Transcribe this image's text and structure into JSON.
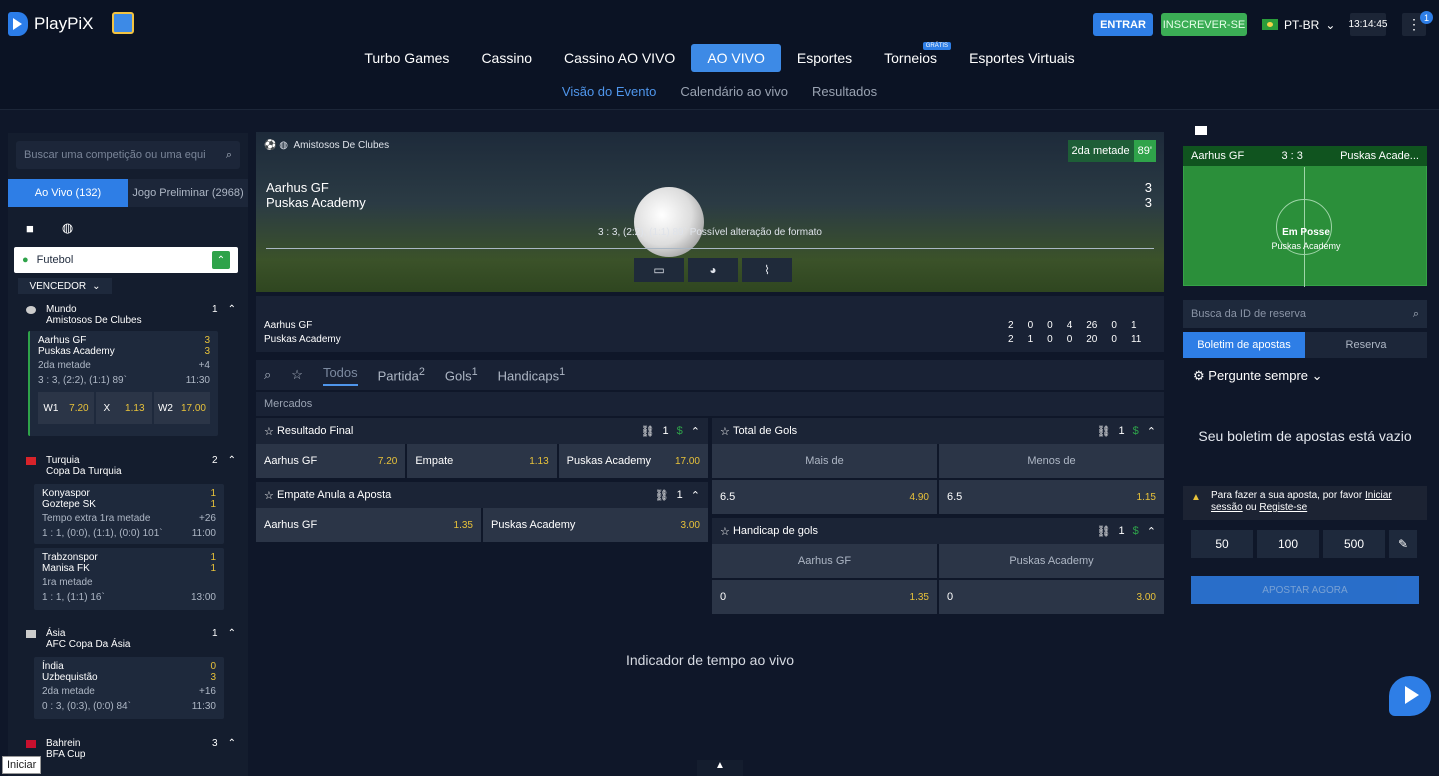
{
  "brand": "PlayPiX",
  "header": {
    "entrar": "ENTRAR",
    "inscrever": "INSCREVER-SE",
    "lang": "PT-BR",
    "clock": "13:14:45",
    "notif": "1"
  },
  "nav": [
    {
      "label": "Turbo Games"
    },
    {
      "label": "Cassino"
    },
    {
      "label": "Cassino AO VIVO"
    },
    {
      "label": "AO VIVO",
      "active": true
    },
    {
      "label": "Esportes"
    },
    {
      "label": "Torneios",
      "badge": "GRÁTIS"
    },
    {
      "label": "Esportes Virtuais"
    }
  ],
  "subnav": [
    {
      "label": "Visão do Evento",
      "active": true
    },
    {
      "label": "Calendário ao vivo"
    },
    {
      "label": "Resultados"
    }
  ],
  "sidebar": {
    "search_placeholder": "Buscar uma competição ou uma equi",
    "tab_live": "Ao Vivo (132)",
    "tab_pre": "Jogo Preliminar (2968)",
    "sport": "Futebol",
    "vencedor": "VENCEDOR",
    "groups": [
      {
        "region": "Mundo",
        "comp": "Amistosos De Clubes",
        "count": "1"
      },
      {
        "region": "Turquia",
        "comp": "Copa Da Turquia",
        "count": "2"
      },
      {
        "region": "Ásia",
        "comp": "AFC Copa Da Ásia",
        "count": "1"
      },
      {
        "region": "Bahrein",
        "comp": "BFA Cup",
        "count": "3"
      }
    ],
    "matches": [
      {
        "home": "Aarhus GF",
        "away": "Puskas Academy",
        "hs": "3",
        "as": "3",
        "status": "2da metade",
        "more": "+4",
        "score": "3 : 3, (2:2), (1:1) 89`",
        "time": "11:30",
        "w1": "W1",
        "w1v": "7.20",
        "x": "X",
        "xv": "1.13",
        "w2": "W2",
        "w2v": "17.00"
      },
      {
        "home": "Konyaspor",
        "away": "Goztepe SK",
        "hs": "1",
        "as": "1",
        "status": "Tempo extra 1ra metade",
        "more": "+26",
        "score": "1 : 1, (0:0), (1:1), (0:0) 101`",
        "time": "11:00"
      },
      {
        "home": "Trabzonspor",
        "away": "Manisa FK",
        "hs": "1",
        "as": "1",
        "status": "1ra metade",
        "more": "",
        "score": "1 : 1, (1:1) 16`",
        "time": "13:00"
      },
      {
        "home": "Índia",
        "away": "Uzbequistão",
        "hs": "0",
        "as": "3",
        "status": "2da metade",
        "more": "+16",
        "score": "0 : 3, (0:3), (0:0) 84`",
        "time": "11:30"
      }
    ]
  },
  "event": {
    "competition": "Amistosos De Clubes",
    "home": "Aarhus GF",
    "away": "Puskas Academy",
    "hs": "3",
    "as": "3",
    "half": "2da metade",
    "minute": "89'",
    "info": "3 : 3, (2:2), (1:1) 89`  Possível alteração de formato",
    "stats_home": [
      "2",
      "0",
      "0",
      "4",
      "26",
      "0",
      "1"
    ],
    "stats_away": [
      "2",
      "1",
      "0",
      "0",
      "20",
      "0",
      "11"
    ]
  },
  "filters": {
    "todos": "Todos",
    "partida": "Partida",
    "partida_n": "2",
    "gols": "Gols",
    "gols_n": "1",
    "handicaps": "Handicaps",
    "handicaps_n": "1",
    "mercados": "Mercados"
  },
  "markets": {
    "resultado": {
      "title": "Resultado Final",
      "n": "1",
      "opts": [
        {
          "l": "Aarhus GF",
          "v": "7.20"
        },
        {
          "l": "Empate",
          "v": "1.13"
        },
        {
          "l": "Puskas Academy",
          "v": "17.00"
        }
      ]
    },
    "empate": {
      "title": "Empate Anula a Aposta",
      "n": "1",
      "opts": [
        {
          "l": "Aarhus GF",
          "v": "1.35"
        },
        {
          "l": "Puskas Academy",
          "v": "3.00"
        }
      ]
    },
    "total": {
      "title": "Total de Gols",
      "n": "1",
      "h1": "Mais de",
      "h2": "Menos de",
      "o1l": "6.5",
      "o1v": "4.90",
      "o2l": "6.5",
      "o2v": "1.15"
    },
    "handicap": {
      "title": "Handicap de gols",
      "n": "1",
      "h1": "Aarhus GF",
      "h2": "Puskas Academy",
      "o1l": "0",
      "o1v": "1.35",
      "o2l": "0",
      "o2v": "3.00"
    }
  },
  "indicator": "Indicador de tempo ao vivo",
  "right": {
    "home": "Aarhus GF",
    "score": "3 : 3",
    "away": "Puskas Acade...",
    "posse": "Em Posse",
    "posse_team": "Puskas Academy",
    "search_placeholder": "Busca da ID de reserva",
    "tab1": "Boletim de apostas",
    "tab2": "Reserva",
    "pergunte": "Pergunte sempre",
    "empty": "Seu boletim de apostas está vazio",
    "warn": "Para fazer a sua aposta, por favor",
    "iniciar": "Iniciar sessão",
    "ou": "ou",
    "registe": "Registe-se",
    "amts": [
      "50",
      "100",
      "500"
    ],
    "apostar": "APOSTAR AGORA"
  },
  "tooltip": "Iniciar"
}
